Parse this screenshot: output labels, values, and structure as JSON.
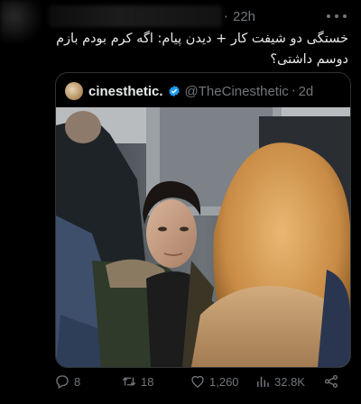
{
  "tweet": {
    "time_sep": "·",
    "time": "22h",
    "text": "خستگی دو شیفت کار + دیدن پیام: اگه کرم بودم بازم دوسم داشتی؟"
  },
  "quote": {
    "name": "cinesthetic.",
    "handle": "@TheCinesthetic",
    "dot": "·",
    "date": "2d"
  },
  "actions": {
    "replies": "8",
    "retweets": "18",
    "likes": "1,260",
    "views": "32.8K"
  },
  "colors": {
    "background": "#000000",
    "text": "#e7e9ea",
    "muted": "#71767b",
    "verified": "#1d9bf0",
    "border": "#2f3336"
  },
  "icons": [
    "more-icon",
    "verified-icon",
    "reply-icon",
    "retweet-icon",
    "like-icon",
    "views-icon",
    "share-icon"
  ]
}
